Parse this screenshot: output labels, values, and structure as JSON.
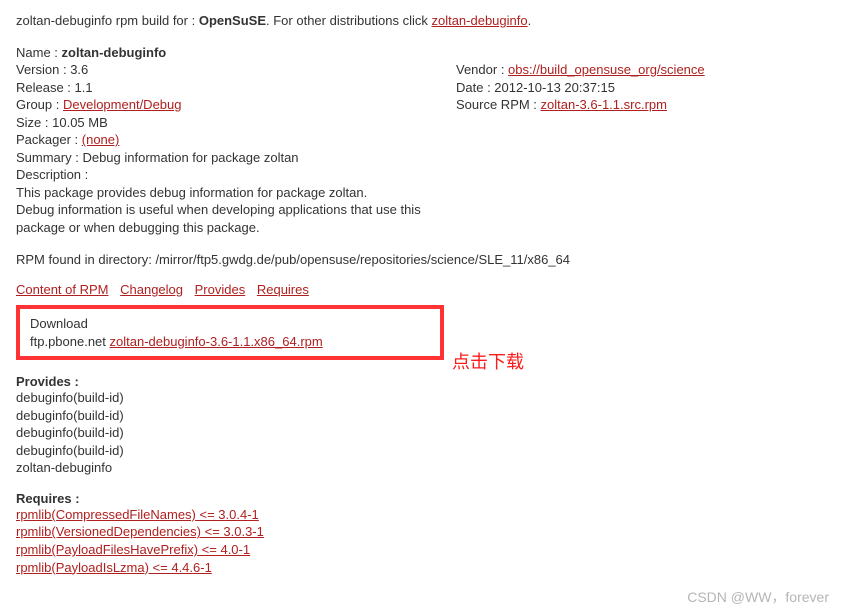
{
  "header": {
    "prefix": "zoltan-debuginfo rpm build for : ",
    "distro": "OpenSuSE",
    "mid": ". For other distributions click ",
    "link": "zoltan-debuginfo",
    "suffix": "."
  },
  "meta": {
    "name_label": "Name : ",
    "name_value": "zoltan-debuginfo",
    "version": "Version : 3.6",
    "release": "Release : 1.1",
    "group_label": "Group : ",
    "group_link": "Development/Debug",
    "size": "Size : 10.05 MB",
    "packager_label": "Packager : ",
    "packager_link": "(none)",
    "summary": "Summary : Debug information for package zoltan",
    "description_label": "Description :",
    "vendor_label": "Vendor : ",
    "vendor_link": "obs://build_opensuse_org/science",
    "date": "Date : 2012-10-13 20:37:15",
    "source_label": "Source RPM : ",
    "source_link": "zoltan-3.6-1.1.src.rpm"
  },
  "description": {
    "l1": "This package provides debug information for package zoltan.",
    "l2": "Debug information is useful when developing applications that use this",
    "l3": "package or when debugging this package."
  },
  "rpm_found": "RPM found in directory: /mirror/ftp5.gwdg.de/pub/opensuse/repositories/science/SLE_11/x86_64",
  "links": {
    "content": "Content of RPM",
    "changelog": "Changelog",
    "provides": "Provides",
    "requires": "Requires"
  },
  "download": {
    "title": "Download",
    "host": "ftp.pbone.net ",
    "file": "zoltan-debuginfo-3.6-1.1.x86_64.rpm"
  },
  "annotation": "点击下载",
  "provides": {
    "title": "Provides :",
    "items": [
      "debuginfo(build-id)",
      "debuginfo(build-id)",
      "debuginfo(build-id)",
      "debuginfo(build-id)",
      "zoltan-debuginfo"
    ]
  },
  "requires": {
    "title": "Requires :",
    "items": [
      "rpmlib(CompressedFileNames) <= 3.0.4-1",
      "rpmlib(VersionedDependencies) <= 3.0.3-1",
      "rpmlib(PayloadFilesHavePrefix) <= 4.0-1",
      "rpmlib(PayloadIsLzma) <= 4.4.6-1"
    ]
  },
  "watermark": "CSDN @WW，forever"
}
